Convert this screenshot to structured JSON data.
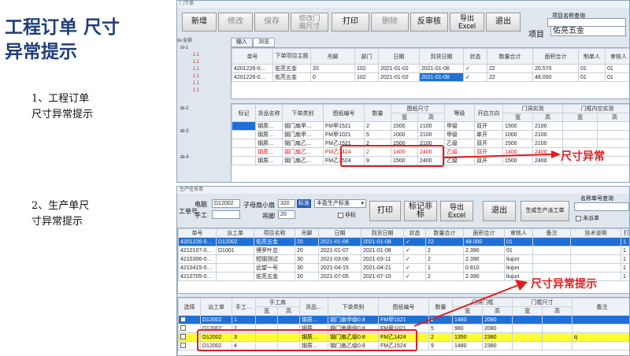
{
  "left": {
    "title_line1": "工程订单 尺寸",
    "title_line2": "异常提示",
    "caption1_line1": "1、工程订单",
    "caption1_line2": "尺寸异常提示",
    "caption2_line1": "2、生产单尺",
    "caption2_line2": "寸异常提示"
  },
  "annotations": {
    "top": "尺寸异常",
    "bottom": "尺寸异常提示"
  },
  "colors": {
    "title": "#1f3f7a",
    "annotation": "#e11d1d",
    "selected_row": "#1f6fd6",
    "highlight_row": "#ffff33"
  },
  "top_window": {
    "title": "门下单",
    "toolbar": {
      "new": "新增",
      "edit": "修改",
      "save": "保存",
      "edit_door_size_l1": "修改门",
      "edit_door_size_l2": "扇尺寸",
      "print": "打印",
      "delete": "删除",
      "unaudit": "反审核",
      "export_l1": "导出",
      "export_l2": "Excel",
      "exit": "退出"
    },
    "search": {
      "label": "项目名称查询",
      "project_label": "项目",
      "project_value": "佑亮五金"
    },
    "tabs": [
      "输入",
      "浏览"
    ],
    "tree": {
      "root": "全部",
      "items": [
        "1",
        "1.1",
        "1.1",
        "1.1",
        "1.1",
        "1.1",
        "1.1",
        "2",
        "3",
        "4"
      ]
    },
    "orders": {
      "headers": [
        "单号",
        "下单项目主题",
        "吊脚",
        "部门",
        "日期",
        "到货日期",
        "状态",
        "数量合计",
        "面积合计",
        "制单人",
        "审核人"
      ],
      "rows": [
        [
          "4201226-0…",
          "佑亮五金",
          "20",
          "102",
          "2021-01-02",
          "2021-01-06",
          "✓",
          "22",
          "20.570",
          "01",
          "01"
        ],
        [
          "4201226-0…",
          "佑亮五金",
          "0",
          "102",
          "2021-01-02",
          "2021-01-08",
          "✓",
          "22",
          "48.000",
          "01",
          "01"
        ]
      ]
    },
    "details": {
      "headers_top": [
        "标记",
        "货品名称",
        "下单类别",
        "图纸编号",
        "数量",
        "图纸尺寸",
        "等级",
        "开启方向",
        "门洞实测",
        "门框内空实测"
      ],
      "headers_sub": [
        "宽",
        "高",
        "宽",
        "高",
        "宽",
        "高"
      ],
      "rows": [
        [
          "",
          "钢质…",
          "钢门扇甲…",
          "FM甲1521",
          "2",
          "1500",
          "2100",
          "甲级",
          "双开",
          "1500",
          "2100",
          ""
        ],
        [
          "",
          "钢质…",
          "钢门扇甲…",
          "FM甲1021",
          "5",
          "1000",
          "2100",
          "甲级",
          "单开",
          "1000",
          "2100",
          ""
        ],
        [
          "",
          "钢质…",
          "钢门扇乙…",
          "FM乙1521",
          "2",
          "1500",
          "2100",
          "乙级",
          "双开",
          "1500",
          "2100",
          ""
        ],
        [
          "",
          "钢质…",
          "钢门扇乙…",
          "FM乙1424",
          "2",
          "1400",
          "2400",
          "乙级",
          "双开",
          "1400",
          "2400",
          ""
        ],
        [
          "",
          "钢质…",
          "钢门扇乙…",
          "FM乙1524",
          "9",
          "1500",
          "2400",
          "乙级",
          "双开",
          "1500",
          "2400",
          ""
        ]
      ]
    }
  },
  "bottom_window": {
    "title": "生产任务单",
    "form": {
      "order_label": "工单号",
      "computer_label": "电脑",
      "computer_value": "D12002",
      "worker_label": "手工",
      "child_label": "子母扇小扇",
      "child_value": "320",
      "hanging_label": "吊脚",
      "hanging_value": "20",
      "standard_label": "标准",
      "standard_value": "丰盈生产标准",
      "nonstd_label": "非标"
    },
    "toolbar": {
      "print": "打印",
      "mark_nonstd_l1": "标记非",
      "mark_nonstd_l2": "标",
      "export_l1": "导出",
      "export_l2": "Excel",
      "exit": "退出",
      "gen_work_order": "生成生产派工单"
    },
    "search": {
      "label": "名称单号查询",
      "unlisted_label": "未派单"
    },
    "orders": {
      "headers": [
        "单号",
        "派工单",
        "项目名称",
        "吊脚",
        "日期",
        "到货日期",
        "状态",
        "数量合计",
        "面积合计",
        "审核人",
        "备注",
        "技术说明",
        "打"
      ],
      "rows": [
        [
          "4201226-0…",
          "D12002",
          "佑亮五金",
          "20",
          "2021-01-06",
          "2021-01-08",
          "✓",
          "22",
          "48.000",
          "01",
          "",
          "",
          "1"
        ],
        [
          "4210107-0…",
          "D1001",
          "博罗叶总",
          "20",
          "2021-01-07",
          "2021-01-08",
          "✓",
          "2",
          "2.390",
          "01",
          "",
          "",
          "1"
        ],
        [
          "4210306-0…",
          "",
          "短钢测试",
          "30",
          "2021-03-06",
          "2021-03-11",
          "✓",
          "2",
          "2.390",
          "liujun",
          "",
          "",
          "1"
        ],
        [
          "4210415-0…",
          "",
          "远望一号",
          "30",
          "2021-04-15",
          "2021-04-21",
          "✓",
          "1",
          "0.810",
          "liujun",
          "",
          "",
          "1"
        ],
        [
          "4210705-0…",
          "",
          "佑亮五金",
          "20",
          "2021-07-05",
          "2021-07-15",
          "✓",
          "2",
          "2.390",
          "liujun",
          "",
          "",
          "1"
        ]
      ]
    },
    "details": {
      "headers_top": [
        "选择",
        "派工单",
        "手工…",
        "手工扇",
        "货品…",
        "下单类别",
        "图纸编号",
        "数量",
        "门洞门框",
        "门框尺寸",
        "备注"
      ],
      "headers_sub": [
        "宽",
        "高",
        "宽",
        "高",
        "宽",
        "高"
      ],
      "rows": [
        [
          "",
          "D12002",
          "1",
          "",
          "",
          "钢质…",
          "钢门扇甲级0.8",
          "FM甲1521",
          "2",
          "1480",
          "2080",
          "",
          "",
          ""
        ],
        [
          "",
          "D12002",
          "2",
          "",
          "",
          "钢质…",
          "钢门扇甲级0.8",
          "FM甲1021",
          "5",
          "980",
          "2080",
          "",
          "",
          ""
        ],
        [
          "",
          "D12002",
          "3",
          "",
          "",
          "钢质…",
          "钢门扇乙级0.8",
          "FM乙1424",
          "2",
          "1350",
          "2380",
          "",
          "",
          "q"
        ],
        [
          "",
          "D12002",
          "4",
          "",
          "",
          "钢质…",
          "钢门扇乙级0.8",
          "FM乙1524",
          "9",
          "1480",
          "2380",
          "",
          "",
          ""
        ]
      ]
    }
  }
}
